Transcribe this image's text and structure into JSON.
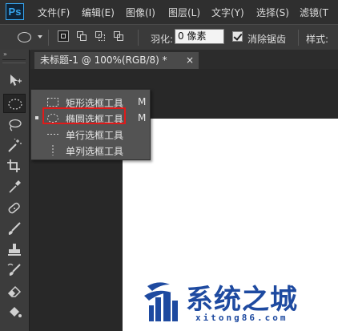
{
  "app": {
    "logo": "Ps"
  },
  "menubar": {
    "items": [
      "文件(F)",
      "编辑(E)",
      "图像(I)",
      "图层(L)",
      "文字(Y)",
      "选择(S)",
      "滤镜(T"
    ]
  },
  "options_bar": {
    "feather_label": "羽化:",
    "feather_value": "0 像素",
    "anti_alias_label": "消除锯齿",
    "anti_alias_checked": true,
    "style_label": "样式:"
  },
  "document_tab": {
    "title": "未标题-1 @ 100%(RGB/8) *",
    "close": "×"
  },
  "toolbar": {
    "collapse": "»",
    "tools": [
      "move-tool",
      "elliptical-marquee-tool",
      "lasso-tool",
      "magic-wand-tool",
      "crop-tool",
      "eyedropper-tool",
      "spot-healing-tool",
      "brush-tool",
      "clone-stamp-tool",
      "history-brush-tool",
      "eraser-tool",
      "paint-bucket-tool"
    ]
  },
  "flyout": {
    "items": [
      {
        "label": "矩形选框工具",
        "shortcut": "M",
        "icon": "rect-marquee-icon"
      },
      {
        "label": "椭圆选框工具",
        "shortcut": "M",
        "icon": "ellipse-marquee-icon",
        "selected": true
      },
      {
        "label": "单行选框工具",
        "shortcut": "",
        "icon": "single-row-marquee-icon"
      },
      {
        "label": "单列选框工具",
        "shortcut": "",
        "icon": "single-column-marquee-icon"
      }
    ]
  },
  "watermark": {
    "title": "系统之城",
    "url": "xitong86.com"
  },
  "colors": {
    "highlight": "#e01a1a",
    "ps_blue": "#37a6f0",
    "watermark": "#1e4aa0"
  }
}
